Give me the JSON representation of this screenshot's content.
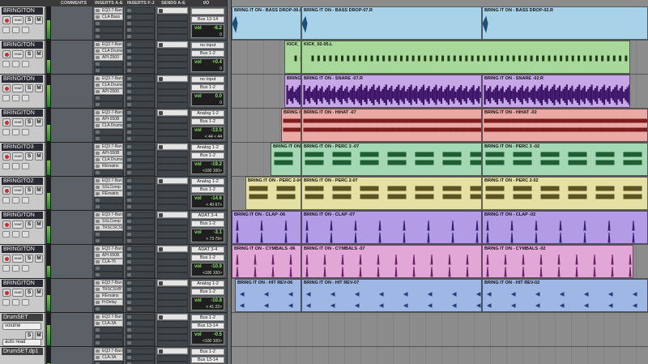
{
  "columns": {
    "comments": "COMMENTS",
    "inserts_ae": "INSERTS A-E",
    "inserts_fj": "INSERTS F-J",
    "sends_ae": "SENDS A-E",
    "io": "I/O"
  },
  "track_buttons": {
    "solo": "S",
    "mute": "M",
    "lane": "read"
  },
  "aux_labels": {
    "automation": "auto read"
  },
  "tracks": [
    {
      "name": "BRINGITON",
      "type": "audio",
      "inserts": [
        "EQ3 7-Band",
        "CLA Bass"
      ],
      "io_in": "",
      "io_out": "Bus 13-14",
      "vol": "-6.2",
      "pan": "0",
      "bus_label": "",
      "meter": 0.6
    },
    {
      "name": "BRINGITON",
      "type": "audio",
      "inserts": [
        "EQ3 7-Band",
        "CLA Drums",
        "API-2500"
      ],
      "io_in": "no input",
      "io_out": "Bus 1-2",
      "vol": "+0.4",
      "pan": "0",
      "bus_label": "",
      "meter": 0.4
    },
    {
      "name": "BRINGITON",
      "type": "audio",
      "inserts": [
        "EQ3 7-Band",
        "CLA Drums",
        "API-2500"
      ],
      "io_in": "no input",
      "io_out": "Bus 1-2",
      "vol": "0.0",
      "pan": "0",
      "bus_label": "",
      "meter": 0.7
    },
    {
      "name": "BRINGITON",
      "type": "audio",
      "inserts": [
        "EQ3 7-Band",
        "API-550B",
        "CLA Drums"
      ],
      "io_in": "Analog 1-2",
      "io_out": "Bus 1-2",
      "vol": "-13.5",
      "pan": "< 44   < 44",
      "bus_label": "",
      "meter": 0.5
    },
    {
      "name": "BRINGITO3",
      "type": "audio",
      "inserts": [
        "EQ3 7-Band",
        "API-550B",
        "CLA Drums",
        "REmatrix"
      ],
      "io_in": "Analog 1-2",
      "io_out": "Bus 1-2",
      "vol": "-19.2",
      "pan": "<100   100>",
      "bus_label": "",
      "meter": 0.45
    },
    {
      "name": "BRINGITO2",
      "type": "audio",
      "inserts": [
        "EQ3 7-Band",
        "SSLComp",
        "REmatrix"
      ],
      "io_in": "Analog 1-2",
      "io_out": "Bus 1-2",
      "vol": "-14.6",
      "pan": "< 40   67>",
      "bus_label": "",
      "meter": 0.5
    },
    {
      "name": "BRINGITON",
      "type": "audio",
      "inserts": [
        "EQ3 7-Band",
        "SSLComp",
        "TRSCSCSR"
      ],
      "io_in": "ADAT 3-4",
      "io_out": "Bus 1-2",
      "vol": "-3.1",
      "pan": "< 73   79>",
      "bus_label": "",
      "meter": 0.55
    },
    {
      "name": "BRINGITON",
      "type": "audio",
      "inserts": [
        "EQ3 7-Band",
        "API-550B",
        "CLA-76"
      ],
      "io_in": "ADAT 3-4",
      "io_out": "Bus 1-2",
      "vol": "-10.9",
      "pan": "<100   100>",
      "bus_label": "",
      "meter": 0.35
    },
    {
      "name": "BRINGITON",
      "type": "audio",
      "inserts": [
        "EQ3 7-Band",
        "TRSCSVBT3",
        "REmatrix",
        "H-Delay"
      ],
      "io_in": "Analog 1-2",
      "io_out": "Bus 1-2",
      "vol": "-10.8",
      "pan": "< 41   22>",
      "bus_label": "",
      "meter": 0.5
    },
    {
      "name": "DrumSET",
      "type": "aux",
      "inserts": [
        "EQ3 7-Band",
        "CLA-3A"
      ],
      "io_in": "Bus 1-2",
      "io_out": "Bus 13-14",
      "vol": "-0.5",
      "pan": "<100   100>",
      "bus_label": "volume",
      "meter": 0.65
    },
    {
      "name": "DrumSET.dp1",
      "type": "aux",
      "inserts": [
        "EQ3 7-Band",
        "CLA-3A"
      ],
      "io_in": "Bus 1-2",
      "io_out": "Bus 13-14",
      "vol": "",
      "pan": "",
      "bus_label": "",
      "meter": 0.5
    }
  ],
  "clips": [
    [
      {
        "name": "BRING IT ON - BASS DROP-06.l",
        "start": 0,
        "end": 86,
        "color": "#a8d2e8"
      },
      {
        "name": "BRING IT ON - BASS DROP-07.R",
        "start": 86,
        "end": 309,
        "color": "#a8d2e8"
      },
      {
        "name": "BRING IT ON - BASS DROP-02.R",
        "start": 309,
        "end": 514,
        "color": "#a8d2e8"
      }
    ],
    [
      {
        "name": "KICK_",
        "start": 65,
        "end": 86,
        "color": "#a9d99a"
      },
      {
        "name": "KICK_02-05.L",
        "start": 86,
        "end": 492,
        "color": "#a9d99a"
      }
    ],
    [
      {
        "name": "BRING",
        "start": 65,
        "end": 86,
        "color": "#c7a7e6"
      },
      {
        "name": "BRING IT ON - SNARE -07.R",
        "start": 86,
        "end": 309,
        "color": "#c7a7e6"
      },
      {
        "name": "BRING IT ON - SNARE -02.R",
        "start": 309,
        "end": 492,
        "color": "#c7a7e6"
      }
    ],
    [
      {
        "name": "BRING I",
        "start": 61,
        "end": 86,
        "color": "#eba9a5"
      },
      {
        "name": "BRING IT ON - HIHAT -07",
        "start": 86,
        "end": 309,
        "color": "#eba9a5"
      },
      {
        "name": "BRING IT ON - HIHAT -02",
        "start": 309,
        "end": 514,
        "color": "#eba9a5"
      }
    ],
    [
      {
        "name": "BRING IT ON",
        "start": 48,
        "end": 86,
        "color": "#a4d8b5"
      },
      {
        "name": "BRING IT ON - PERC 3 -07",
        "start": 86,
        "end": 309,
        "color": "#a4d8b5"
      },
      {
        "name": "BRING IT ON - PERC 3 -02",
        "start": 309,
        "end": 514,
        "color": "#a4d8b5"
      }
    ],
    [
      {
        "name": "BRING IT ON - PERC 2-04",
        "start": 17,
        "end": 86,
        "color": "#e5e0a4"
      },
      {
        "name": "BRING IT ON - PERC 2-07",
        "start": 86,
        "end": 309,
        "color": "#e5e0a4"
      },
      {
        "name": "BRING IT ON - PERC 2-02",
        "start": 309,
        "end": 514,
        "color": "#e5e0a4"
      }
    ],
    [
      {
        "name": "BRING IT ON - CLAP -06",
        "start": 0,
        "end": 86,
        "color": "#b49be6"
      },
      {
        "name": "BRING IT ON - CLAP -07",
        "start": 86,
        "end": 309,
        "color": "#b49be6"
      },
      {
        "name": "BRING IT ON - CLAP -02",
        "start": 309,
        "end": 514,
        "color": "#b49be6"
      }
    ],
    [
      {
        "name": "BRING IT ON - CYMBALS -06",
        "start": 0,
        "end": 86,
        "color": "#e3a7d7"
      },
      {
        "name": "BRING IT ON - CYMBALS -07",
        "start": 86,
        "end": 309,
        "color": "#e3a7d7"
      },
      {
        "name": "BRING IT ON - CYMBALS -02",
        "start": 309,
        "end": 496,
        "color": "#e3a7d7"
      }
    ],
    [
      {
        "name": "BRING IT ON - HIT REV-06",
        "start": 4,
        "end": 86,
        "color": "#9fb7e4"
      },
      {
        "name": "BRING IT ON - HIT REV-07",
        "start": 86,
        "end": 309,
        "color": "#9fb7e4"
      },
      {
        "name": "BRING IT ON - HIT REV-02",
        "start": 309,
        "end": 514,
        "color": "#9fb7e4"
      }
    ],
    [],
    []
  ],
  "wave_styles": [
    "drop",
    "kick",
    "dense",
    "hihat",
    "perc",
    "perc",
    "clap",
    "cym",
    "rev",
    "",
    ""
  ],
  "wave_colors": [
    "#1d4f76",
    "#1e3a17",
    "#3d1568",
    "#7a1c1c",
    "#1d5e33",
    "#5a5420",
    "#33226f",
    "#6c2463",
    "#213f7a",
    "",
    ""
  ]
}
